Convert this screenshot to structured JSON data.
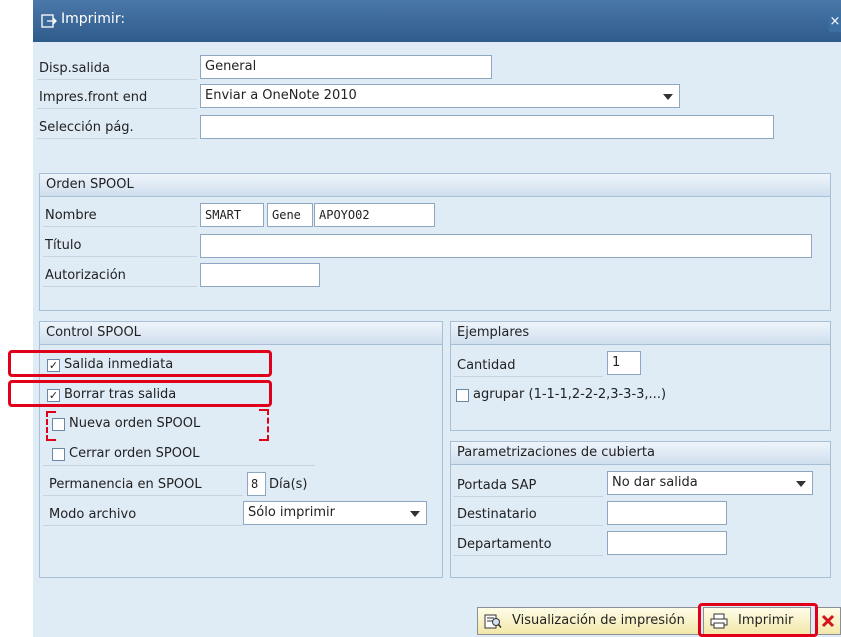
{
  "window": {
    "title": "Imprimir:",
    "close_glyph": "×"
  },
  "form": {
    "output_device": {
      "label": "Disp.salida",
      "value": "General"
    },
    "frontend_printer": {
      "label": "Impres.front end",
      "value": "Enviar a OneNote 2010"
    },
    "page_selection": {
      "label": "Selección pág.",
      "value": ""
    }
  },
  "spool_request": {
    "title": "Orden SPOOL",
    "name_label": "Nombre",
    "name_parts": [
      "SMART",
      "Gene",
      "APOYO02"
    ],
    "title_label": "Título",
    "title_value": "",
    "auth_label": "Autorización",
    "auth_value": ""
  },
  "spool_control": {
    "title": "Control SPOOL",
    "print_now": {
      "label": "Salida inmediata",
      "checked": true
    },
    "delete_after": {
      "label": "Borrar tras salida",
      "checked": true
    },
    "new_request": {
      "label": "Nueva orden SPOOL",
      "checked": false
    },
    "close_request": {
      "label": "Cerrar orden SPOOL",
      "checked": false
    },
    "retention_label": "Permanencia en SPOOL",
    "retention_value": "8",
    "retention_unit": "Día(s)",
    "archive_label": "Modo archivo",
    "archive_value": "Sólo imprimir"
  },
  "copies": {
    "title": "Ejemplares",
    "quantity_label": "Cantidad",
    "quantity_value": "1",
    "collate": {
      "label": "agrupar (1-1-1,2-2-2,3-3-3,...)",
      "checked": false
    }
  },
  "cover": {
    "title": "Parametrizaciones de cubierta",
    "sap_cover_label": "Portada SAP",
    "sap_cover_value": "No dar salida",
    "recipient_label": "Destinatario",
    "recipient_value": "",
    "department_label": "Departamento",
    "department_value": ""
  },
  "footer": {
    "preview_button": "Visualización de impresión",
    "print_button": "Imprimir"
  },
  "colors": {
    "highlight": "#e1001a",
    "title_bar": "#3b6796",
    "background": "#dfebf5"
  },
  "icons": [
    "print-dialog-icon",
    "close-icon",
    "print-preview-icon",
    "printer-icon",
    "cancel-icon"
  ]
}
